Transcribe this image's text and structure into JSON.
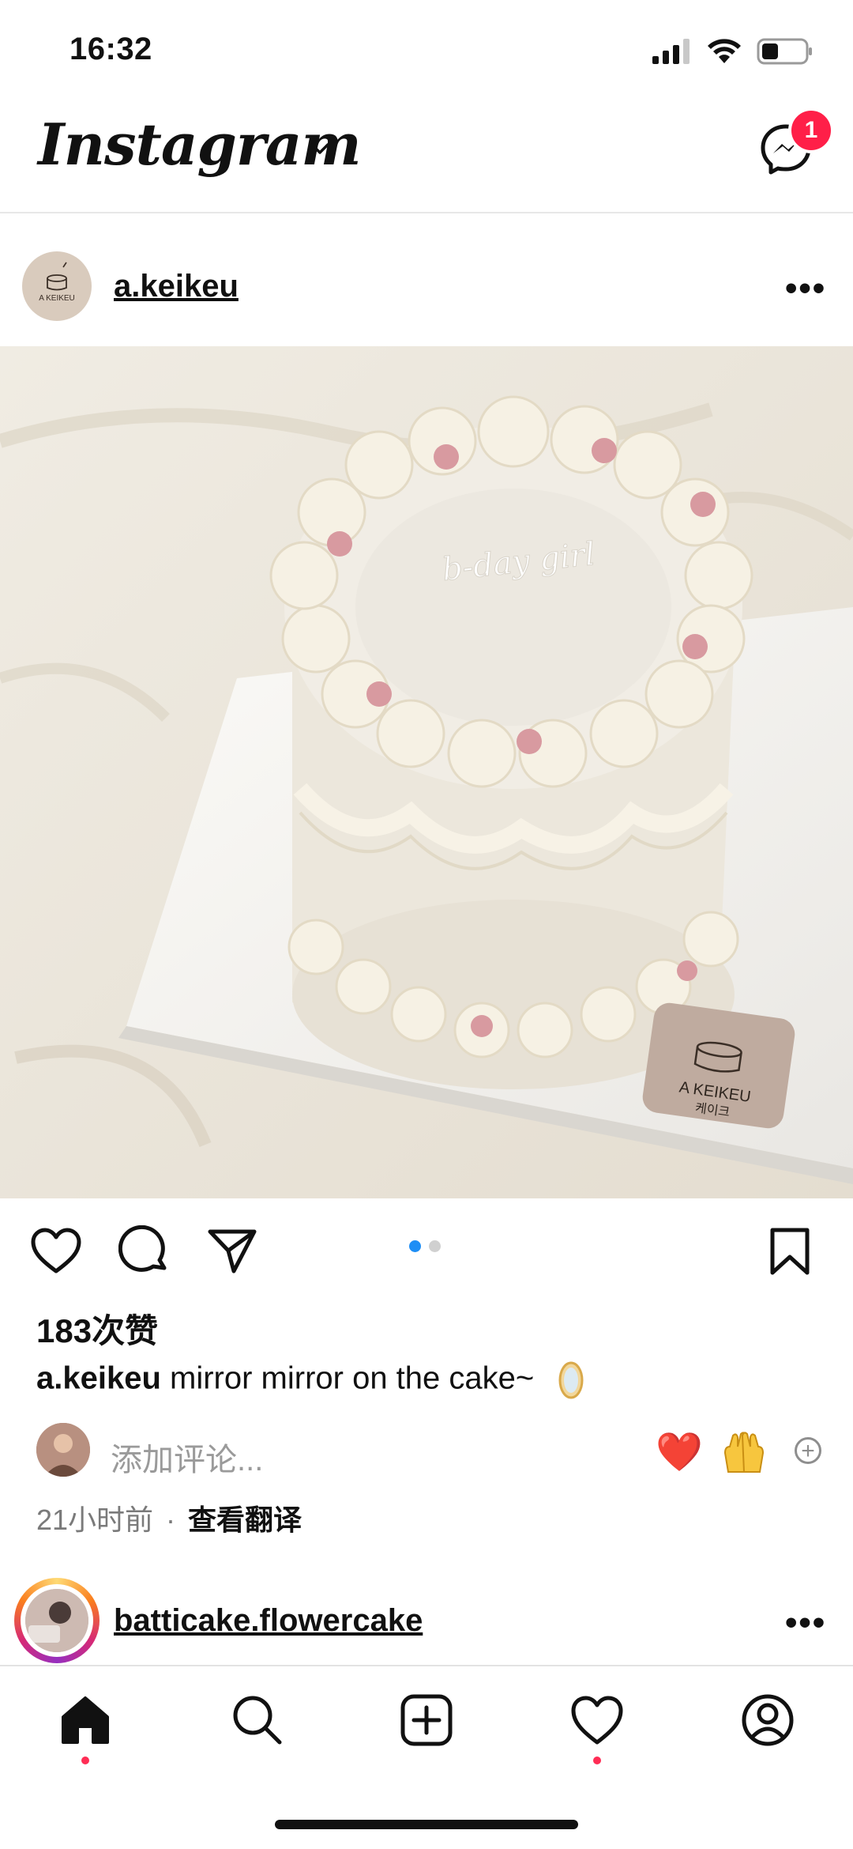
{
  "status_bar": {
    "time": "16:32"
  },
  "header": {
    "logo": "Instagram",
    "messages_badge": "1"
  },
  "post1": {
    "username": "a.keikeu",
    "more": "•••",
    "image_icons": [
      "cake-photo"
    ],
    "cake_text": "b-day girl",
    "brand_card": {
      "line1": "A KEIKEU",
      "line2": "케이크"
    },
    "carousel": {
      "total": 2,
      "active": 1
    },
    "likes": "183次赞",
    "caption_user": "a.keikeu",
    "caption_text": "mirror mirror on the cake~",
    "comment_placeholder": "添加评论...",
    "quick_emojis": [
      "❤️",
      "🙌"
    ],
    "time_ago": "21小时前",
    "separator": "·",
    "translate": "查看翻译"
  },
  "post2": {
    "username": "batticake.flowercake",
    "more": "•••"
  },
  "tabbar": {
    "items": [
      "home-icon",
      "search-icon",
      "create-icon",
      "activity-icon",
      "profile-icon"
    ],
    "active": "home"
  },
  "colors": {
    "badge": "#ff1f48",
    "carousel_active": "#1e8ef5",
    "notification_dot": "#ff2d55"
  }
}
